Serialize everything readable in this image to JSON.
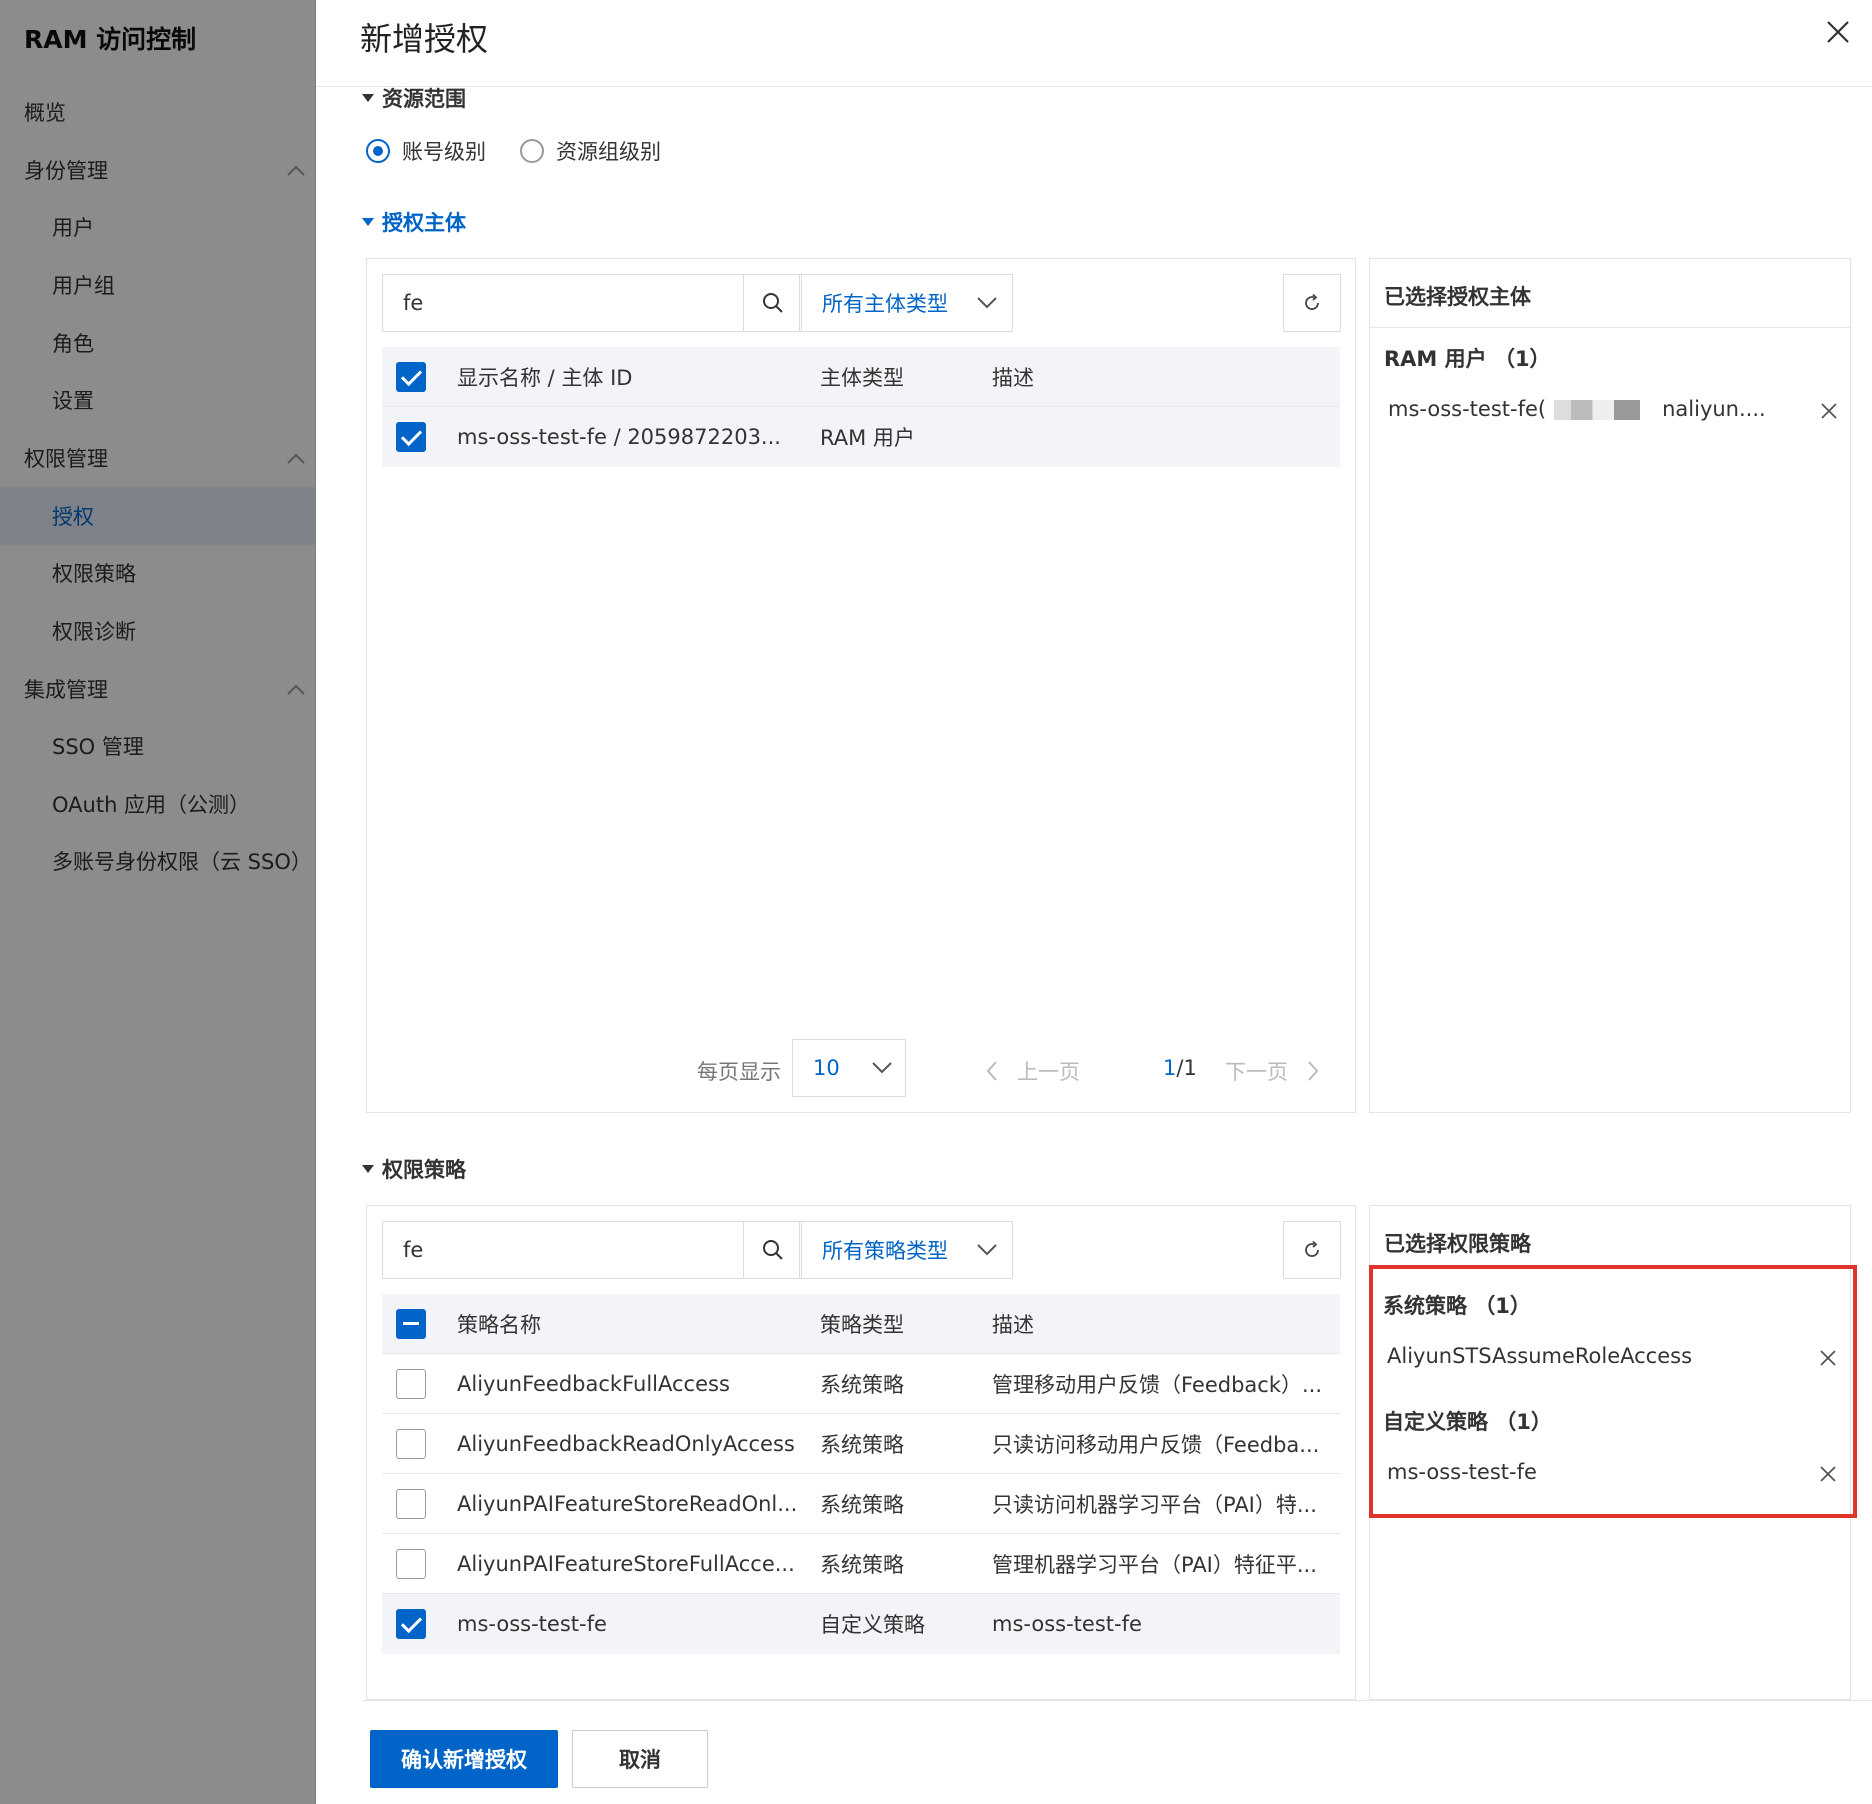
{
  "sidebar": {
    "title": "RAM 访问控制",
    "items": [
      {
        "label": "概览"
      },
      {
        "label": "身份管理"
      },
      {
        "label": "用户"
      },
      {
        "label": "用户组"
      },
      {
        "label": "角色"
      },
      {
        "label": "设置"
      },
      {
        "label": "权限管理"
      },
      {
        "label": "授权"
      },
      {
        "label": "权限策略"
      },
      {
        "label": "权限诊断"
      },
      {
        "label": "集成管理"
      },
      {
        "label": "SSO 管理"
      },
      {
        "label": "OAuth 应用（公测）"
      },
      {
        "label": "多账号身份权限（云 SSO）"
      }
    ]
  },
  "drawer": {
    "title": "新增授权",
    "resource_scope": {
      "title": "资源范围",
      "options": [
        {
          "label": "账号级别",
          "selected": true
        },
        {
          "label": "资源组级别",
          "selected": false
        }
      ]
    },
    "principal": {
      "title": "授权主体",
      "search_value": "fe",
      "type_select": "所有主体类型",
      "columns": [
        "显示名称 / 主体 ID",
        "主体类型",
        "描述"
      ],
      "rows": [
        {
          "name": "ms-oss-test-fe / 2059872203...",
          "type": "RAM 用户",
          "desc": "",
          "checked": true
        }
      ],
      "pager": {
        "per_page_label": "每页显示",
        "per_page": "10",
        "prev": "上一页",
        "current": "1",
        "total": "/1",
        "next": "下一页"
      },
      "selected_panel": {
        "title": "已选择授权主体",
        "group_title": "RAM 用户 （1）",
        "item_prefix": "ms-oss-test-fe(",
        "item_suffix": "naliyun...."
      }
    },
    "policy": {
      "title": "权限策略",
      "search_value": "fe",
      "type_select": "所有策略类型",
      "columns": [
        "策略名称",
        "策略类型",
        "描述"
      ],
      "rows": [
        {
          "name": "AliyunFeedbackFullAccess",
          "type": "系统策略",
          "desc": "管理移动用户反馈（Feedback）...",
          "checked": false
        },
        {
          "name": "AliyunFeedbackReadOnlyAccess",
          "type": "系统策略",
          "desc": "只读访问移动用户反馈（Feedba...",
          "checked": false
        },
        {
          "name": "AliyunPAIFeatureStoreReadOnl...",
          "type": "系统策略",
          "desc": "只读访问机器学习平台（PAI）特...",
          "checked": false
        },
        {
          "name": "AliyunPAIFeatureStoreFullAcce...",
          "type": "系统策略",
          "desc": "管理机器学习平台（PAI）特征平...",
          "checked": false
        },
        {
          "name": "ms-oss-test-fe",
          "type": "自定义策略",
          "desc": "ms-oss-test-fe",
          "checked": true
        }
      ],
      "selected_panel": {
        "title": "已选择权限策略",
        "system_title": "系统策略 （1）",
        "system_item": "AliyunSTSAssumeRoleAccess",
        "custom_title": "自定义策略 （1）",
        "custom_item": "ms-oss-test-fe"
      }
    },
    "buttons": {
      "confirm": "确认新增授权",
      "cancel": "取消"
    }
  },
  "colors": {
    "accent": "#0064c8",
    "highlight": "#e0332a",
    "overlay": "rgba(0,0,0,0.45)"
  }
}
